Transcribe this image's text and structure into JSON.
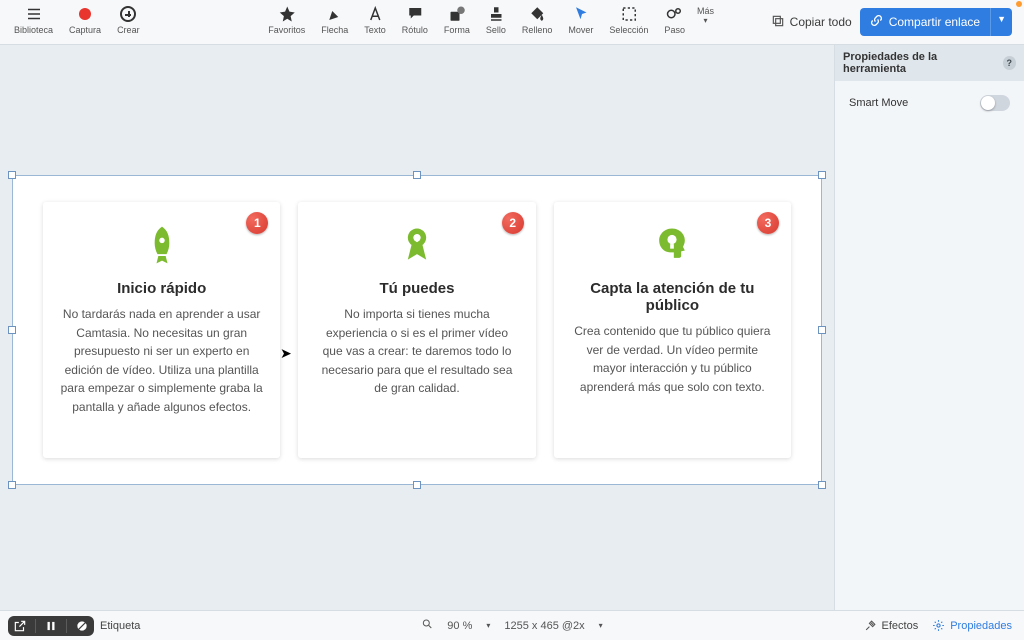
{
  "toolbar": {
    "left": [
      {
        "name": "library-button",
        "label": "Biblioteca",
        "icon": "menu-icon"
      },
      {
        "name": "capture-button",
        "label": "Captura",
        "icon": "record-icon"
      },
      {
        "name": "create-button",
        "label": "Crear",
        "icon": "plus-circle-icon"
      }
    ],
    "center": [
      {
        "name": "favorites-tool",
        "label": "Favoritos",
        "icon": "star-icon"
      },
      {
        "name": "arrow-tool",
        "label": "Flecha",
        "icon": "arrow-tool-icon"
      },
      {
        "name": "text-tool",
        "label": "Texto",
        "icon": "text-a-icon"
      },
      {
        "name": "callout-tool",
        "label": "Rótulo",
        "icon": "speech-bubble-icon"
      },
      {
        "name": "shape-tool",
        "label": "Forma",
        "icon": "shapes-icon"
      },
      {
        "name": "stamp-tool",
        "label": "Sello",
        "icon": "stamp-icon"
      },
      {
        "name": "fill-tool",
        "label": "Relleno",
        "icon": "bucket-icon"
      },
      {
        "name": "move-tool",
        "label": "Mover",
        "icon": "move-cursor-icon"
      },
      {
        "name": "selection-tool",
        "label": "Selección",
        "icon": "marquee-icon"
      },
      {
        "name": "step-tool",
        "label": "Paso",
        "icon": "step-icon"
      }
    ],
    "more_label": "Más",
    "copy_all_label": "Copiar todo",
    "share_label": "Compartir enlace"
  },
  "right_panel": {
    "title": "Propiedades de la herramienta",
    "smart_move_label": "Smart Move"
  },
  "cards": [
    {
      "badge": "1",
      "title": "Inicio rápido",
      "body": "No tardarás nada en aprender a usar Camtasia. No necesitas un gran presupuesto ni ser un experto en edición de vídeo. Utiliza una plantilla para empezar o simplemente graba la pantalla y añade algunos efectos."
    },
    {
      "badge": "2",
      "title": "Tú puedes",
      "body": "No importa si tienes mucha experiencia o si es el primer vídeo que vas a crear: te daremos todo lo necesario para que el resultado sea de gran calidad."
    },
    {
      "badge": "3",
      "title": "Capta la atención de tu público",
      "body": "Crea contenido que tu público quiera ver de verdad. Un vídeo permite mayor interacción y tu público aprenderá más que solo con texto."
    }
  ],
  "status": {
    "tag_label": "Etiqueta",
    "zoom": "90 %",
    "dims": "1255 x 465 @2x",
    "effects_label": "Efectos",
    "properties_label": "Propiedades"
  },
  "colors": {
    "accent": "#2f7de1",
    "green": "#7cbb2f",
    "badge": "#e8352e"
  }
}
